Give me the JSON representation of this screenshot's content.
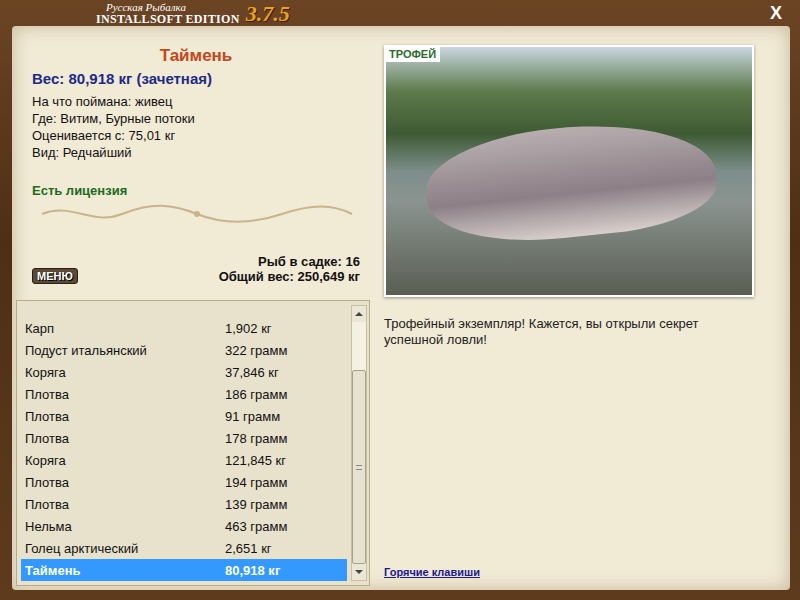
{
  "window": {
    "logo_line1": "Русская Рыбалка",
    "logo_line2": "INSTALLSOFT EDITION",
    "version": "3.7.5",
    "close": "X"
  },
  "fish": {
    "name": "Таймень",
    "weight": "Вес: 80,918 кг (зачетная)",
    "details": [
      "На что поймана: живец",
      "Где: Витим, Бурные потоки",
      "Оценивается с: 75,01 кг",
      "Вид: Редчайший"
    ],
    "license": "Есть лицензия"
  },
  "menu_button": "МЕНЮ",
  "keepnet": {
    "count": "Рыб в садке: 16",
    "total": "Общий вес: 250,649 кг"
  },
  "catch_list": {
    "rows": [
      {
        "name": "Карп",
        "weight": "1,902 кг",
        "selected": false
      },
      {
        "name": "Подуст итальянский",
        "weight": "322 грамм",
        "selected": false
      },
      {
        "name": "Коряга",
        "weight": "37,846 кг",
        "selected": false
      },
      {
        "name": "Плотва",
        "weight": "186 грамм",
        "selected": false
      },
      {
        "name": "Плотва",
        "weight": "91 грамм",
        "selected": false
      },
      {
        "name": "Плотва",
        "weight": "178 грамм",
        "selected": false
      },
      {
        "name": "Коряга",
        "weight": "121,845 кг",
        "selected": false
      },
      {
        "name": "Плотва",
        "weight": "194 грамм",
        "selected": false
      },
      {
        "name": "Плотва",
        "weight": "139 грамм",
        "selected": false
      },
      {
        "name": "Нельма",
        "weight": "463 грамм",
        "selected": false
      },
      {
        "name": "Голец арктический",
        "weight": "2,651 кг",
        "selected": false
      },
      {
        "name": "Таймень",
        "weight": "80,918 кг",
        "selected": true
      }
    ],
    "scrollbar": {
      "position": 1,
      "thumb_share": 0.8
    }
  },
  "photo": {
    "badge": "ТРОФЕЙ"
  },
  "message": "Трофейный экземпляр! Кажется, вы открыли секрет успешной ловли!",
  "hotkeys_link": "Горячие клавиши"
}
